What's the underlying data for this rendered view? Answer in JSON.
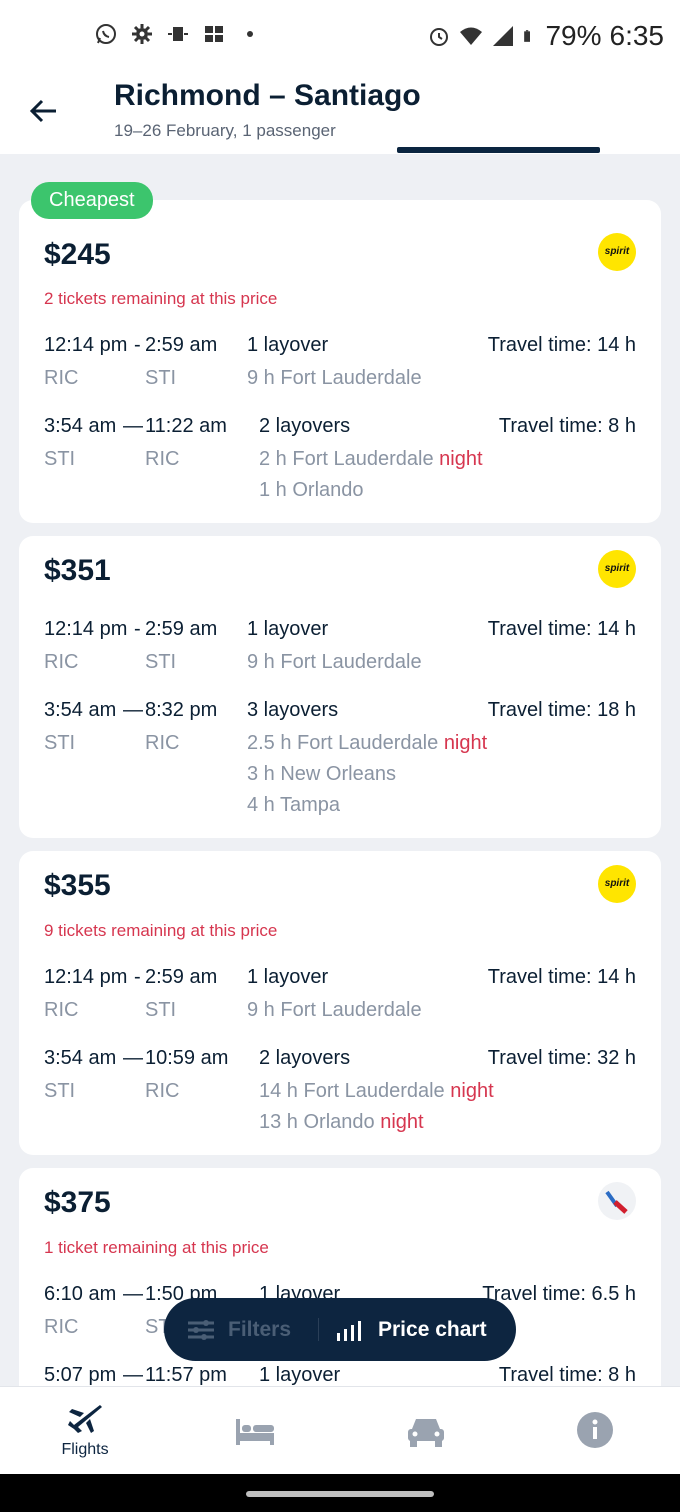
{
  "status": {
    "battery": "79%",
    "time": "6:35"
  },
  "header": {
    "title": "Richmond – Santiago",
    "subtitle": "19–26 February, 1 passenger"
  },
  "badge": "Cheapest",
  "results": [
    {
      "price": "$245",
      "airline": "spirit",
      "logo_text": "spirit",
      "remaining": "2 tickets remaining at this price",
      "out": {
        "dep": "12:14 pm",
        "sep": "-",
        "arr": "2:59 am",
        "from": "RIC",
        "to": "STI",
        "layovers": "1 layover",
        "travel": "Travel time: 14 h",
        "stops": [
          {
            "text": "9 h Fort Lauderdale",
            "night": ""
          }
        ]
      },
      "ret": {
        "dep": "3:54 am",
        "sep": "—",
        "arr": "11:22 am",
        "from": "STI",
        "to": "RIC",
        "layovers": "2 layovers",
        "travel": "Travel time: 8 h",
        "stops": [
          {
            "text": "2 h Fort Lauderdale",
            "night": "night"
          },
          {
            "text": "1 h Orlando",
            "night": ""
          }
        ]
      }
    },
    {
      "price": "$351",
      "airline": "spirit",
      "logo_text": "spirit",
      "remaining": "",
      "out": {
        "dep": "12:14 pm",
        "sep": "-",
        "arr": "2:59 am",
        "from": "RIC",
        "to": "STI",
        "layovers": "1 layover",
        "travel": "Travel time: 14 h",
        "stops": [
          {
            "text": "9 h Fort Lauderdale",
            "night": ""
          }
        ]
      },
      "ret": {
        "dep": "3:54 am",
        "sep": "—",
        "arr": "8:32 pm",
        "from": "STI",
        "to": "RIC",
        "layovers": "3 layovers",
        "travel": "Travel time: 18 h",
        "stops": [
          {
            "text": "2.5 h Fort Lauderdale",
            "night": "night"
          },
          {
            "text": "3 h New Orleans",
            "night": ""
          },
          {
            "text": "4 h Tampa",
            "night": ""
          }
        ]
      }
    },
    {
      "price": "$355",
      "airline": "spirit",
      "logo_text": "spirit",
      "remaining": "9 tickets remaining at this price",
      "out": {
        "dep": "12:14 pm",
        "sep": "-",
        "arr": "2:59 am",
        "from": "RIC",
        "to": "STI",
        "layovers": "1 layover",
        "travel": "Travel time: 14 h",
        "stops": [
          {
            "text": "9 h Fort Lauderdale",
            "night": ""
          }
        ]
      },
      "ret": {
        "dep": "3:54 am",
        "sep": "—",
        "arr": "10:59 am",
        "from": "STI",
        "to": "RIC",
        "layovers": "2 layovers",
        "travel": "Travel time: 32 h",
        "stops": [
          {
            "text": "14 h Fort Lauderdale",
            "night": "night"
          },
          {
            "text": "13 h Orlando",
            "night": "night"
          }
        ]
      }
    },
    {
      "price": "$375",
      "airline": "american",
      "remaining": "1 ticket remaining at this price",
      "out": {
        "dep": "6:10 am",
        "sep": "—",
        "arr": "1:50 pm",
        "from": "RIC",
        "to": "STI",
        "layovers": "1 layover",
        "travel": "Travel time: 6.5 h"
      },
      "ret": {
        "dep": "5:07 pm",
        "sep": "—",
        "arr": "11:57 pm",
        "layovers": "1 layover",
        "travel": "Travel time: 8 h"
      }
    }
  ],
  "floating": {
    "filters": "Filters",
    "price_chart": "Price chart"
  },
  "nav": {
    "flights": "Flights"
  },
  "icons": [
    "whatsapp-icon",
    "settings-icon",
    "cast-icon",
    "map-icon",
    "alarm-icon",
    "wifi-icon",
    "signal-icon",
    "battery-icon",
    "back-arrow-icon",
    "filter-icon",
    "bar-chart-icon",
    "airplane-icon",
    "bed-icon",
    "car-icon",
    "info-icon"
  ],
  "colors": {
    "accent_dark": "#0d2540",
    "cheapest_green": "#3cc56d",
    "warning_red": "#d6364f",
    "spirit_yellow": "#ffe500"
  }
}
